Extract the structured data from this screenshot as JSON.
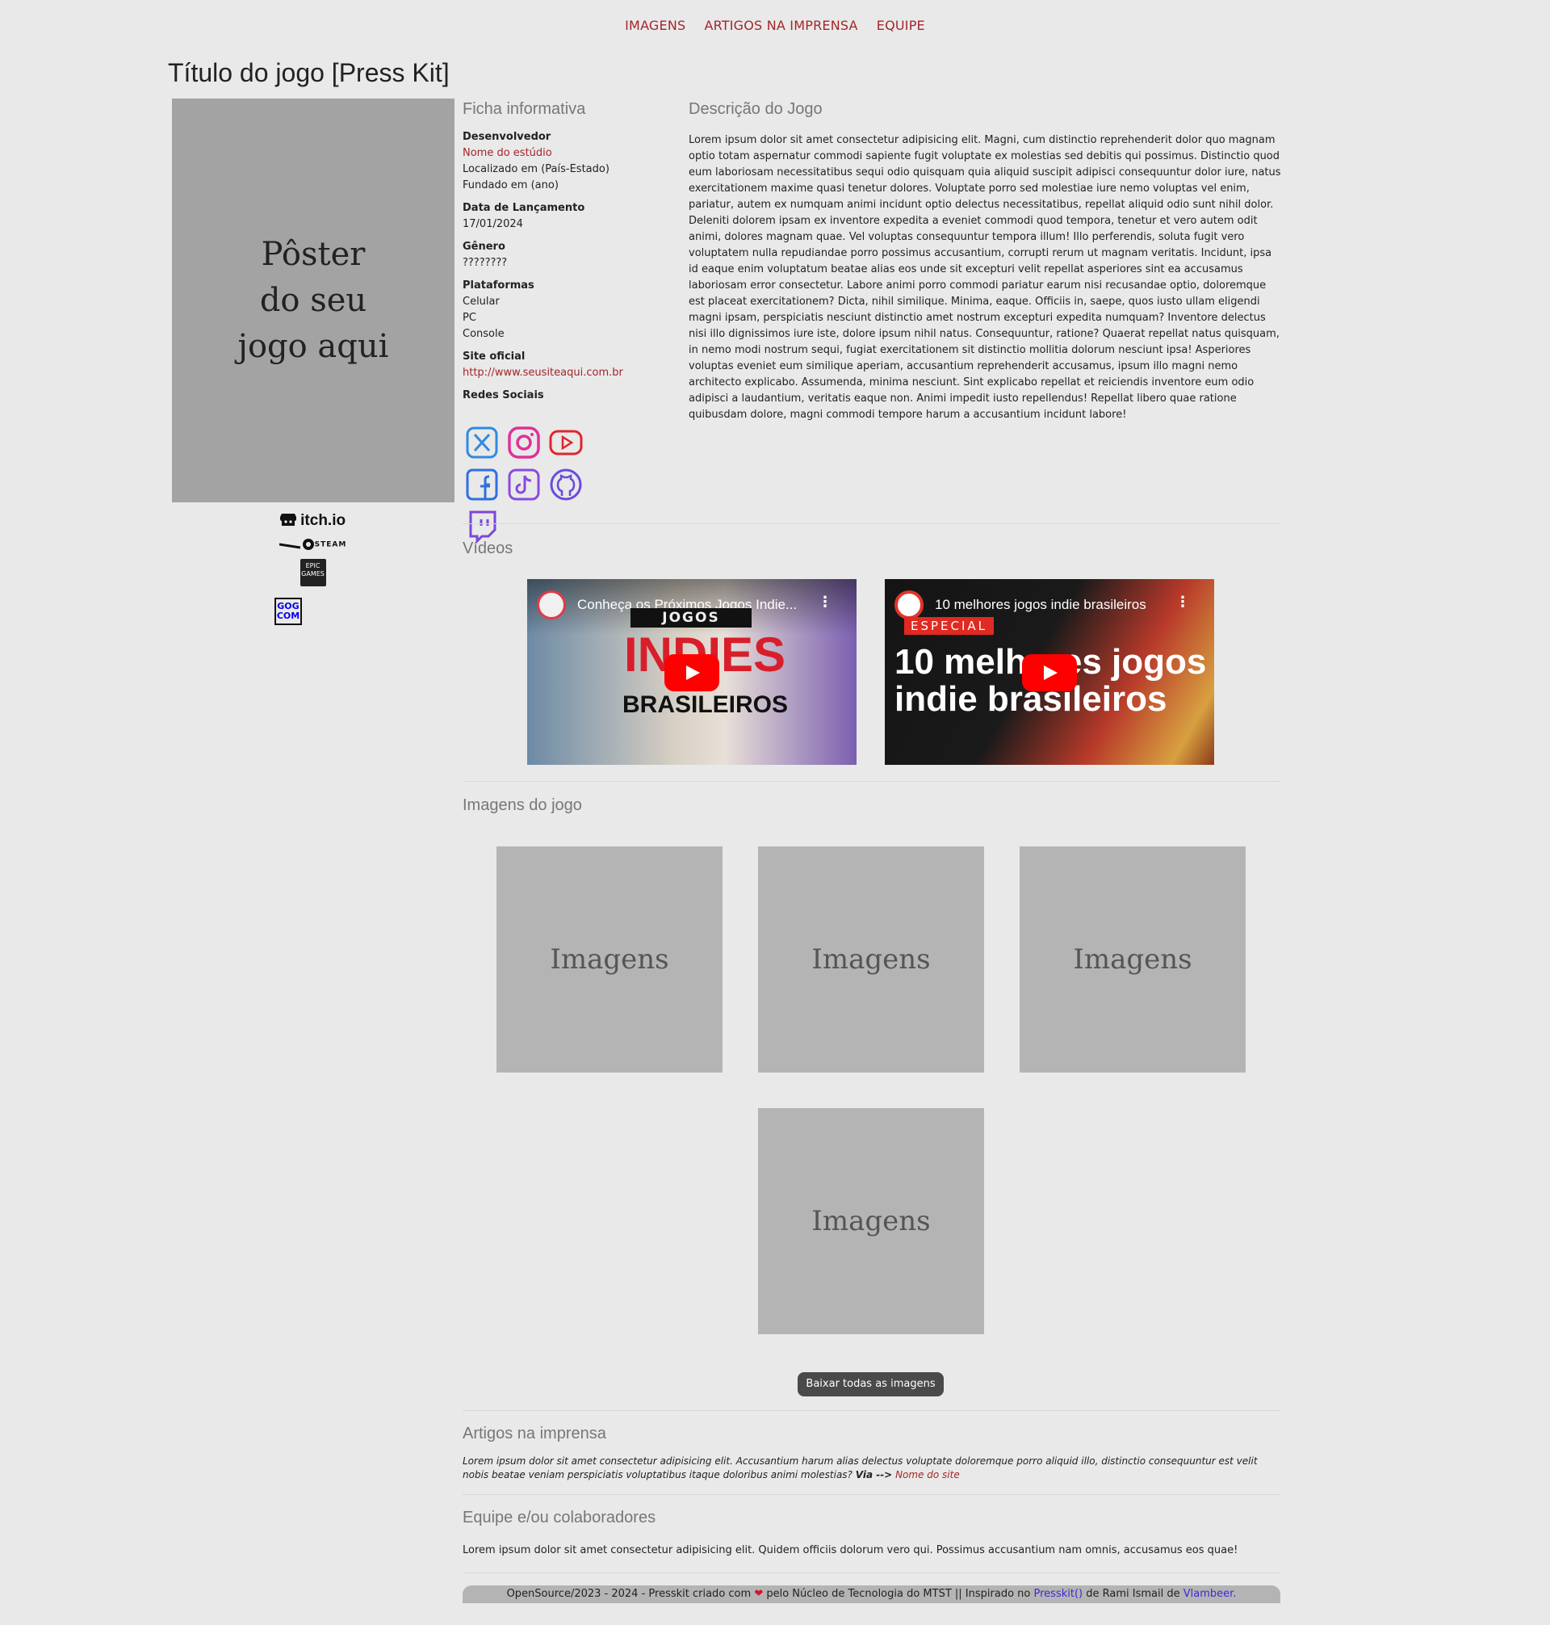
{
  "nav": {
    "items": [
      "IMAGENS",
      "ARTIGOS NA IMPRENSA",
      "EQUIPE"
    ]
  },
  "page_title": "Título do jogo [Press Kit]",
  "poster": {
    "text": "Pôster\ndo seu\njogo aqui"
  },
  "stores": {
    "itch": "itch.io",
    "steam": "STEAM",
    "epic": "EPIC GAMES",
    "gog": "GOG COM"
  },
  "fact_sheet": {
    "heading": "Ficha informativa",
    "developer_label": "Desenvolvedor",
    "studio_name": "Nome do estúdio",
    "location": "Localizado em (País-Estado)",
    "founded": "Fundado em (ano)",
    "release_label": "Data de Lançamento",
    "release_date": "17/01/2024",
    "genre_label": "Gênero",
    "genre": "????????",
    "platforms_label": "Plataformas",
    "platforms": [
      "Celular",
      "PC",
      "Console"
    ],
    "site_label": "Site oficial",
    "site_url": "http://www.seusiteaqui.com.br",
    "social_label": "Redes Sociais",
    "social_icons": [
      "x-icon",
      "instagram-icon",
      "youtube-icon",
      "facebook-icon",
      "tiktok-icon",
      "github-icon",
      "twitch-icon"
    ],
    "social_colors": {
      "x": "#2f8ae0",
      "instagram": "#e0309a",
      "youtube": "#e0262a",
      "facebook": "#2f6fe0",
      "tiktok": "#8a4ae0",
      "github": "#6b4ae0",
      "twitch": "#7a48d8"
    }
  },
  "description": {
    "heading": "Descrição do Jogo",
    "text": "Lorem ipsum dolor sit amet consectetur adipisicing elit. Magni, cum distinctio reprehenderit dolor quo magnam optio totam aspernatur commodi sapiente fugit voluptate ex molestias sed debitis qui possimus. Distinctio quod eum laboriosam necessitatibus sequi odio quisquam quia aliquid suscipit adipisci consequuntur dolor iure, natus exercitationem maxime quasi tenetur dolores. Voluptate porro sed molestiae iure nemo voluptas vel enim, pariatur, autem ex numquam animi incidunt optio delectus necessitatibus, repellat aliquid odio sunt nihil dolor. Deleniti dolorem ipsam ex inventore expedita a eveniet commodi quod tempora, tenetur et vero autem odit animi, dolores magnam quae. Vel voluptas consequuntur tempora illum! Illo perferendis, soluta fugit vero voluptatem nulla repudiandae porro possimus accusantium, corrupti rerum ut magnam veritatis. Incidunt, ipsa id eaque enim voluptatum beatae alias eos unde sit excepturi velit repellat asperiores sint ea accusamus laboriosam error consectetur. Labore animi porro commodi pariatur earum nisi recusandae optio, doloremque est placeat exercitationem? Dicta, nihil similique. Minima, eaque. Officiis in, saepe, quos iusto ullam eligendi magni ipsam, perspiciatis nesciunt distinctio amet nostrum excepturi expedita numquam? Inventore delectus nisi illo dignissimos iure iste, dolore ipsum nihil natus. Consequuntur, ratione? Quaerat repellat natus quisquam, in nemo modi nostrum sequi, fugiat exercitationem sit distinctio mollitia dolorum nesciunt ipsa! Asperiores voluptas eveniet eum similique aperiam, accusantium reprehenderit accusamus, ipsum illo magni nemo architecto explicabo. Assumenda, minima nesciunt. Sint explicabo repellat et reiciendis inventore eum odio adipisci a laudantium, veritatis eaque non. Animi impedit iusto repellendus! Repellat libero quae ratione quibusdam dolore, magni commodi tempore harum a accusantium incidunt labore!"
  },
  "videos": {
    "heading": "Vídeos",
    "items": [
      {
        "title": "Conheça os Próximos Jogos Indie...",
        "thumb_line1": "JOGOS",
        "thumb_line2": "INDIES",
        "thumb_line3": "BRASILEIROS"
      },
      {
        "title": "10 melhores jogos indie brasileiros",
        "tag": "ESPECIAL",
        "thumb_line1": "10 melhores jogos",
        "thumb_line2": "indie brasileiros"
      }
    ]
  },
  "images": {
    "heading": "Imagens do jogo",
    "tiles": [
      "Imagens",
      "Imagens",
      "Imagens",
      "Imagens"
    ],
    "download_button": "Baixar todas as imagens"
  },
  "press": {
    "heading": "Artigos na imprensa",
    "quote": "Lorem ipsum dolor sit amet consectetur adipisicing elit. Accusantium harum alias delectus voluptate doloremque porro aliquid illo, distinctio consequuntur est velit nobis beatae veniam perspiciatis voluptatibus itaque doloribus animi molestias?",
    "via": "Via -->",
    "site_name": "Nome do site"
  },
  "team": {
    "heading": "Equipe e/ou colaboradores",
    "text": "Lorem ipsum dolor sit amet consectetur adipisicing elit. Quidem officiis dolorum vero qui. Possimus accusantium nam omnis, accusamus eos quae!"
  },
  "footer": {
    "part1": "OpenSource/2023 - 2024 - Presskit criado com",
    "part2": "pelo Núcleo de Tecnologia do MTST || Inspirado no",
    "presskit_link": "Presskit()",
    "part3": "de Rami Ismail de",
    "vlambeer_link": "Vlambeer."
  },
  "colors": {
    "accent": "#a3262a",
    "background": "#e9e9e9",
    "link": "#3a2bd6",
    "placeholder": "#a3a3a3"
  }
}
